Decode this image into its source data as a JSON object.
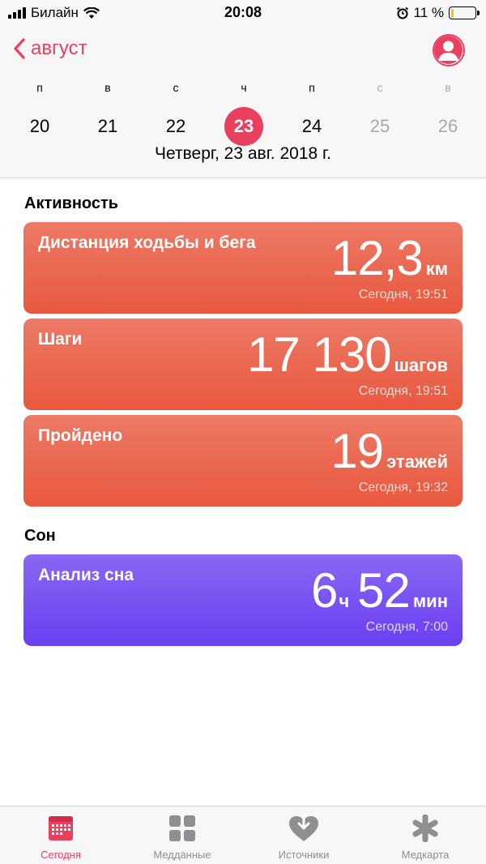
{
  "status_bar": {
    "carrier": "Билайн",
    "time": "20:08",
    "battery_percent": "11 %",
    "battery_level": 0.11
  },
  "header": {
    "back_label": "август",
    "days": [
      {
        "dow": "п",
        "num": "20",
        "weekend": false,
        "selected": false
      },
      {
        "dow": "в",
        "num": "21",
        "weekend": false,
        "selected": false
      },
      {
        "dow": "с",
        "num": "22",
        "weekend": false,
        "selected": false
      },
      {
        "dow": "ч",
        "num": "23",
        "weekend": false,
        "selected": true
      },
      {
        "dow": "п",
        "num": "24",
        "weekend": false,
        "selected": false
      },
      {
        "dow": "с",
        "num": "25",
        "weekend": true,
        "selected": false
      },
      {
        "dow": "в",
        "num": "26",
        "weekend": true,
        "selected": false
      }
    ],
    "full_date": "Четверг, 23 авг. 2018 г."
  },
  "activity": {
    "title": "Активность",
    "cards": [
      {
        "label": "Дистанция ходьбы и бега",
        "value": "12,3",
        "unit": "км",
        "time": "Сегодня, 19:51"
      },
      {
        "label": "Шаги",
        "value": "17 130",
        "unit": "шагов",
        "time": "Сегодня, 19:51"
      },
      {
        "label": "Пройдено",
        "value": "19",
        "unit": "этажей",
        "time": "Сегодня, 19:32"
      }
    ]
  },
  "sleep": {
    "title": "Сон",
    "card": {
      "label": "Анализ сна",
      "hours": "6",
      "hours_unit": "ч",
      "minutes": "52",
      "minutes_unit": "мин",
      "time": "Сегодня, 7:00"
    }
  },
  "tabs": [
    {
      "label": "Сегодня",
      "icon": "calendar-icon",
      "active": true
    },
    {
      "label": "Медданные",
      "icon": "grid-icon",
      "active": false
    },
    {
      "label": "Источники",
      "icon": "heart-download-icon",
      "active": false
    },
    {
      "label": "Медкарта",
      "icon": "asterisk-icon",
      "active": false
    }
  ],
  "colors": {
    "accent": "#e94060",
    "activity_top": "#ec7a66",
    "activity_bottom": "#e9573e",
    "sleep_top": "#8a67f5",
    "sleep_bottom": "#6a3ff0"
  }
}
